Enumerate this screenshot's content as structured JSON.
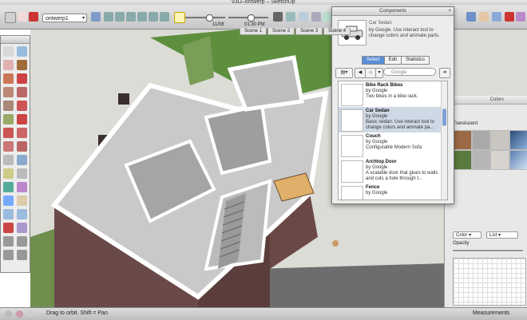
{
  "window": {
    "title": "v3D–ontwerp – SketchUp"
  },
  "toolbar": {
    "layer_value": "ontwerp1",
    "time_start": "11/08",
    "time_end": "01:30 PM"
  },
  "scenes": [
    "Scene 1",
    "Scene 2",
    "Scene 3",
    "Scene 4"
  ],
  "components": {
    "title": "Components",
    "selected_name": "Car Sedan",
    "selected_desc": "by Google. Use interact tool to change colors and animate parts.",
    "tabs": [
      "Select",
      "Edit",
      "Statistics"
    ],
    "search_placeholder": "Google",
    "items": [
      {
        "name": "Bike Rack Bikes",
        "by": "by Google",
        "desc": "Two bikes in a bike rack."
      },
      {
        "name": "Car Sedan",
        "by": "by Google",
        "desc": "Basic sedan.  Use interact tool to change colors and animate pa..."
      },
      {
        "name": "Couch",
        "by": "by Google",
        "desc": "Configurable Modern Sofa"
      },
      {
        "name": "Archtop Door",
        "by": "by Google",
        "desc": "A scalable door that glues to walls and cuts a hole through t..."
      },
      {
        "name": "Fence",
        "by": "by Google",
        "desc": ""
      }
    ]
  },
  "colors": {
    "title": "Colors",
    "category": "Translucent",
    "mode": "Color",
    "view": "List",
    "opacity_label": "Opacity"
  },
  "status": {
    "hint": "Drag to orbit.  Shift = Pan",
    "measurements_label": "Measurements"
  }
}
